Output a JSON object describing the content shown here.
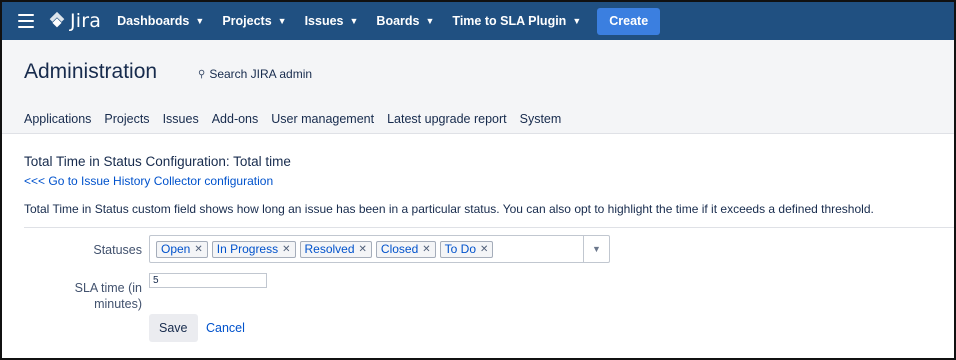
{
  "topnav": {
    "logo_text": "Jira",
    "items": [
      {
        "label": "Dashboards"
      },
      {
        "label": "Projects"
      },
      {
        "label": "Issues"
      },
      {
        "label": "Boards"
      },
      {
        "label": "Time to SLA Plugin"
      }
    ],
    "create_label": "Create",
    "bg_color": "#205081",
    "create_color": "#3b7fe0"
  },
  "admin": {
    "title": "Administration",
    "search_label": "Search JIRA admin",
    "tabs": [
      {
        "label": "Applications"
      },
      {
        "label": "Projects"
      },
      {
        "label": "Issues"
      },
      {
        "label": "Add-ons"
      },
      {
        "label": "User management"
      },
      {
        "label": "Latest upgrade report"
      },
      {
        "label": "System"
      }
    ]
  },
  "page": {
    "heading": "Total Time in Status Configuration: Total time",
    "back_link": "<<< Go to Issue History Collector configuration",
    "description": "Total Time in Status custom field shows how long an issue has been in a particular status. You can also opt to highlight the time if it exceeds a defined threshold."
  },
  "form": {
    "statuses_label": "Statuses",
    "statuses": [
      {
        "label": "Open"
      },
      {
        "label": "In Progress"
      },
      {
        "label": "Resolved"
      },
      {
        "label": "Closed"
      },
      {
        "label": "To Do"
      }
    ],
    "sla_label": "SLA time (in minutes)",
    "sla_value": "5",
    "save_label": "Save",
    "cancel_label": "Cancel"
  }
}
